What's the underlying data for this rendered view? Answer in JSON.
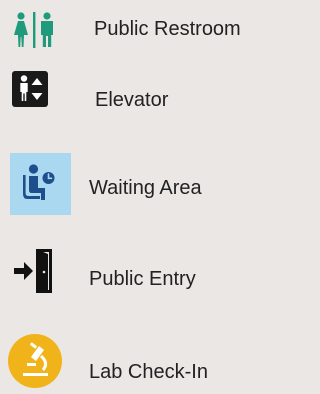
{
  "legend": {
    "items": [
      {
        "label": "Public Restroom",
        "icon": "restroom-icon",
        "color": "#1f9a7a"
      },
      {
        "label": "Elevator",
        "icon": "elevator-icon",
        "color": "#1a1a1a"
      },
      {
        "label": "Waiting Area",
        "icon": "waiting-area-icon",
        "color": "#1f4e8c",
        "background": "#a9d8f0"
      },
      {
        "label": "Public Entry",
        "icon": "entry-icon",
        "color": "#111111"
      },
      {
        "label": "Lab Check-In",
        "icon": "microscope-icon",
        "color": "#ffffff",
        "background": "#f0b319"
      }
    ]
  }
}
